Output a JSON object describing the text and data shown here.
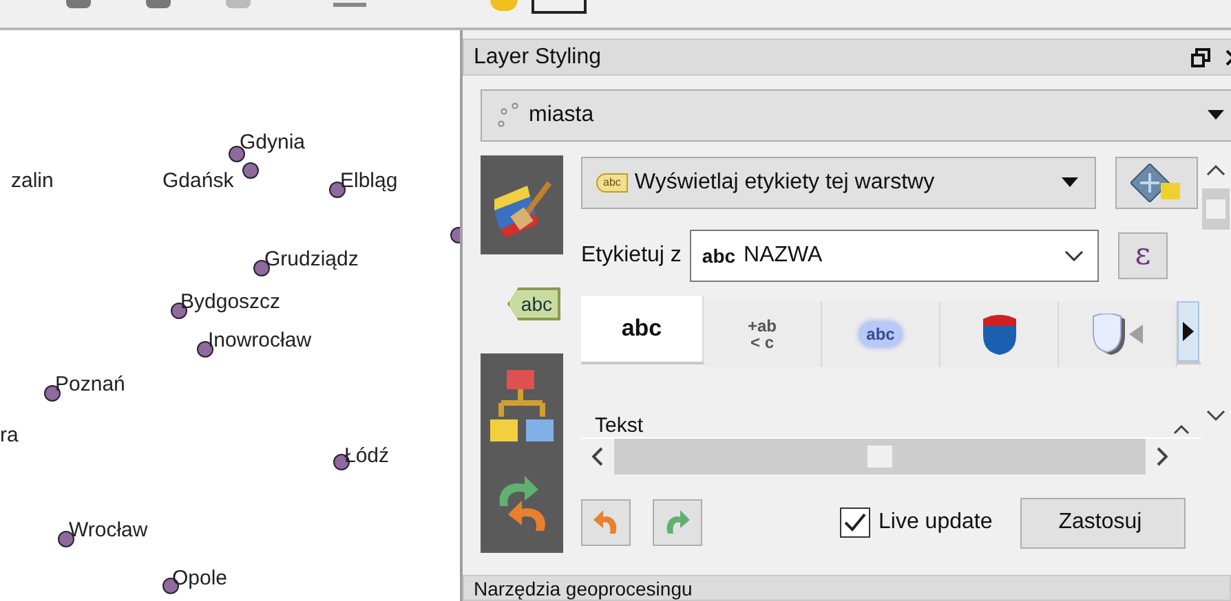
{
  "map": {
    "cities": [
      {
        "name": "zalin",
        "marker": false
      },
      {
        "name": "Gdynia",
        "marker": true
      },
      {
        "name": "Gdańsk",
        "marker": true
      },
      {
        "name": "Elbląg",
        "marker": true
      },
      {
        "marker": true
      },
      {
        "name": "Grudziądz",
        "marker": true
      },
      {
        "name": "Bydgoszcz",
        "marker": true
      },
      {
        "name": "Inowrocław",
        "marker": true
      },
      {
        "name": "Poznań",
        "marker": true
      },
      {
        "name": "ra",
        "marker": false
      },
      {
        "name": "Łódź",
        "marker": true
      },
      {
        "name": "Wrocław",
        "marker": true
      },
      {
        "name": "Opole",
        "marker": true
      }
    ]
  },
  "panel": {
    "title": "Layer Styling",
    "layer": {
      "value": "miasta"
    },
    "side_tabs": [
      {
        "kind": "symbology",
        "selected": false
      },
      {
        "kind": "labels",
        "label": "abc",
        "selected": true
      },
      {
        "kind": "diagrams",
        "selected": false
      },
      {
        "kind": "history",
        "selected": false
      }
    ],
    "renderer": {
      "icon_text": "abc",
      "value": "Wyświetlaj etykiety tej warstwy"
    },
    "label_with": {
      "label": "Etykietuj z",
      "prefix": "abc",
      "value": "NAZWA",
      "expression_button": "ε"
    },
    "tabs": [
      {
        "kind": "text",
        "label": "abc",
        "selected": true
      },
      {
        "kind": "formatting",
        "lines": [
          "+ab",
          "< c"
        ],
        "selected": false
      },
      {
        "kind": "buffer",
        "label": "abc",
        "selected": false
      },
      {
        "kind": "background",
        "selected": false
      },
      {
        "kind": "shadow",
        "selected": false
      }
    ],
    "section": "Tekst",
    "live_update": {
      "label": "Live update",
      "checked": true
    },
    "apply_button": "Zastosuj"
  },
  "bottom_dock": {
    "title": "Narzędzia geoprocesingu"
  }
}
